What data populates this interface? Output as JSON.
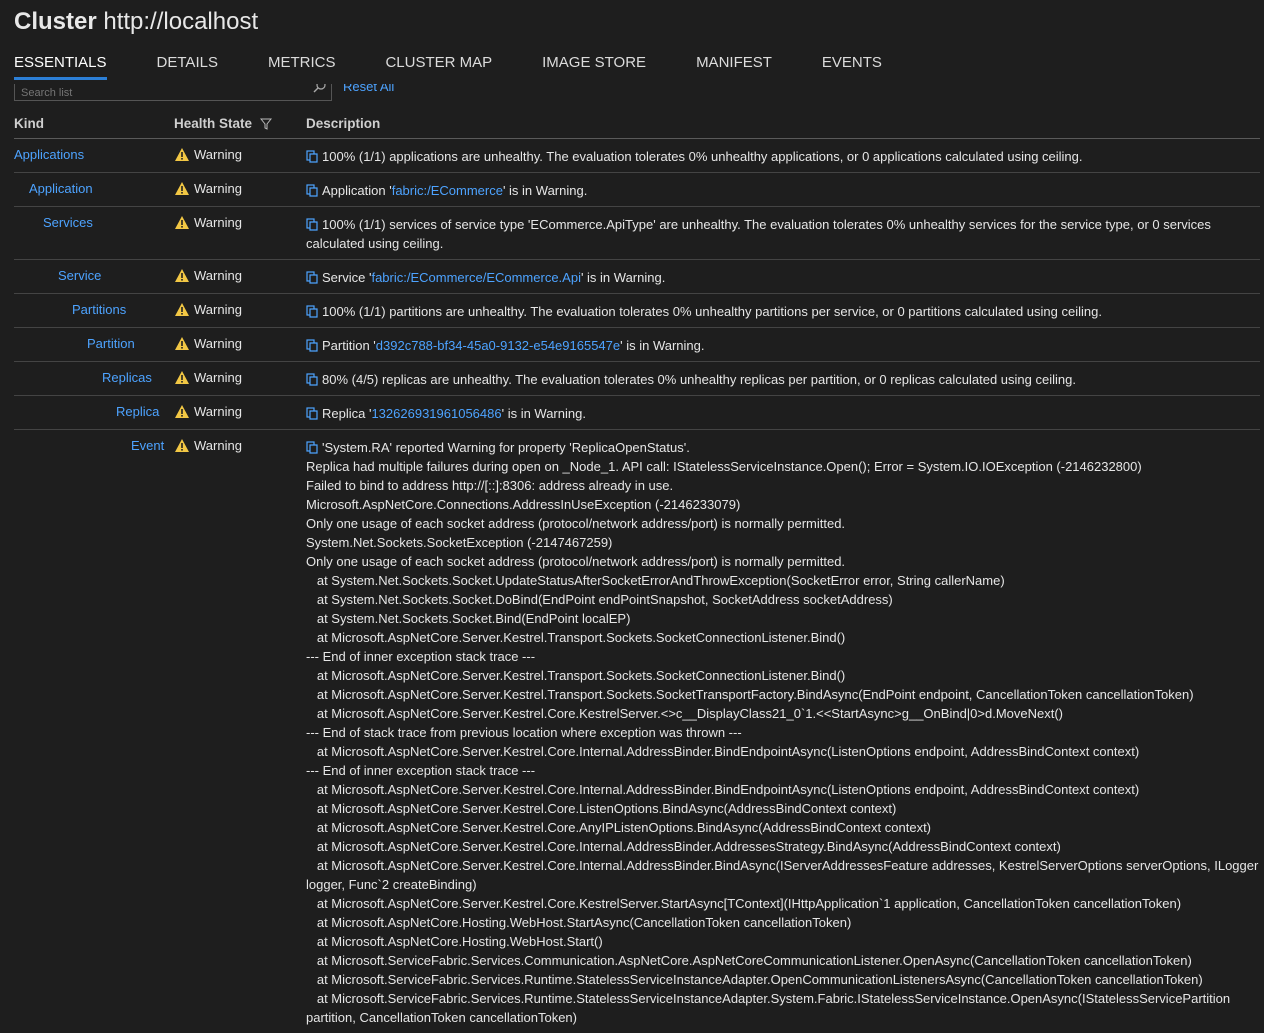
{
  "header": {
    "title_bold": "Cluster",
    "title_rest": "http://localhost"
  },
  "tabs": [
    "ESSENTIALS",
    "DETAILS",
    "METRICS",
    "CLUSTER MAP",
    "IMAGE STORE",
    "MANIFEST",
    "EVENTS"
  ],
  "search": {
    "placeholder": "Search list",
    "reset_label": "Reset All"
  },
  "columns": {
    "kind": "Kind",
    "health": "Health State",
    "description": "Description"
  },
  "rows": [
    {
      "kind": "Applications",
      "health": "Warning",
      "desc": "100% (1/1) applications are unhealthy. The evaluation tolerates 0% unhealthy applications, or 0 applications calculated using ceiling."
    },
    {
      "kind": "Application",
      "health": "Warning",
      "pre": "Application '",
      "link": "fabric:/ECommerce",
      "post": "' is in Warning."
    },
    {
      "kind": "Services",
      "health": "Warning",
      "desc": "100% (1/1) services of service type 'ECommerce.ApiType' are unhealthy. The evaluation tolerates 0% unhealthy services for the service type, or 0 services calculated using ceiling."
    },
    {
      "kind": "Service",
      "health": "Warning",
      "pre": "Service '",
      "link": "fabric:/ECommerce/ECommerce.Api",
      "post": "' is in Warning."
    },
    {
      "kind": "Partitions",
      "health": "Warning",
      "desc": "100% (1/1) partitions are unhealthy. The evaluation tolerates 0% unhealthy partitions per service, or 0 partitions calculated using ceiling."
    },
    {
      "kind": "Partition",
      "health": "Warning",
      "pre": "Partition '",
      "link": "d392c788-bf34-45a0-9132-e54e9165547e",
      "post": "' is in Warning."
    },
    {
      "kind": "Replicas",
      "health": "Warning",
      "desc": "80% (4/5) replicas are unhealthy. The evaluation tolerates 0% unhealthy replicas per partition, or 0 replicas calculated using ceiling."
    },
    {
      "kind": "Replica",
      "health": "Warning",
      "pre": "Replica '",
      "link": "132626931961056486",
      "post": "' is in Warning."
    },
    {
      "kind": "Event",
      "health": "Warning",
      "desc": "'System.RA' reported Warning for property 'ReplicaOpenStatus'.\nReplica had multiple failures during open on _Node_1. API call: IStatelessServiceInstance.Open(); Error = System.IO.IOException (-2146232800)\nFailed to bind to address http://[::]:8306: address already in use.\nMicrosoft.AspNetCore.Connections.AddressInUseException (-2146233079)\nOnly one usage of each socket address (protocol/network address/port) is normally permitted.\nSystem.Net.Sockets.SocketException (-2147467259)\nOnly one usage of each socket address (protocol/network address/port) is normally permitted.\n   at System.Net.Sockets.Socket.UpdateStatusAfterSocketErrorAndThrowException(SocketError error, String callerName)\n   at System.Net.Sockets.Socket.DoBind(EndPoint endPointSnapshot, SocketAddress socketAddress)\n   at System.Net.Sockets.Socket.Bind(EndPoint localEP)\n   at Microsoft.AspNetCore.Server.Kestrel.Transport.Sockets.SocketConnectionListener.Bind()\n--- End of inner exception stack trace ---\n   at Microsoft.AspNetCore.Server.Kestrel.Transport.Sockets.SocketConnectionListener.Bind()\n   at Microsoft.AspNetCore.Server.Kestrel.Transport.Sockets.SocketTransportFactory.BindAsync(EndPoint endpoint, CancellationToken cancellationToken)\n   at Microsoft.AspNetCore.Server.Kestrel.Core.KestrelServer.<>c__DisplayClass21_0`1.<<StartAsync>g__OnBind|0>d.MoveNext()\n--- End of stack trace from previous location where exception was thrown ---\n   at Microsoft.AspNetCore.Server.Kestrel.Core.Internal.AddressBinder.BindEndpointAsync(ListenOptions endpoint, AddressBindContext context)\n--- End of inner exception stack trace ---\n   at Microsoft.AspNetCore.Server.Kestrel.Core.Internal.AddressBinder.BindEndpointAsync(ListenOptions endpoint, AddressBindContext context)\n   at Microsoft.AspNetCore.Server.Kestrel.Core.ListenOptions.BindAsync(AddressBindContext context)\n   at Microsoft.AspNetCore.Server.Kestrel.Core.AnyIPListenOptions.BindAsync(AddressBindContext context)\n   at Microsoft.AspNetCore.Server.Kestrel.Core.Internal.AddressBinder.AddressesStrategy.BindAsync(AddressBindContext context)\n   at Microsoft.AspNetCore.Server.Kestrel.Core.Internal.AddressBinder.BindAsync(IServerAddressesFeature addresses, KestrelServerOptions serverOptions, ILogger logger, Func`2 createBinding)\n   at Microsoft.AspNetCore.Server.Kestrel.Core.KestrelServer.StartAsync[TContext](IHttpApplication`1 application, CancellationToken cancellationToken)\n   at Microsoft.AspNetCore.Hosting.WebHost.StartAsync(CancellationToken cancellationToken)\n   at Microsoft.AspNetCore.Hosting.WebHost.Start()\n   at Microsoft.ServiceFabric.Services.Communication.AspNetCore.AspNetCoreCommunicationListener.OpenAsync(CancellationToken cancellationToken)\n   at Microsoft.ServiceFabric.Services.Runtime.StatelessServiceInstanceAdapter.OpenCommunicationListenersAsync(CancellationToken cancellationToken)\n   at Microsoft.ServiceFabric.Services.Runtime.StatelessServiceInstanceAdapter.System.Fabric.IStatelessServiceInstance.OpenAsync(IStatelessServicePartition partition, CancellationToken cancellationToken)"
    }
  ],
  "colors": {
    "background": "#1e1e1e",
    "link": "#4da3ff",
    "warning": "#f2c744",
    "tab_underline": "#2c7fd6"
  },
  "icons": {
    "warning": "warning-triangle-icon",
    "copy": "copy-icon",
    "filter": "filter-icon",
    "search": "search-icon"
  }
}
